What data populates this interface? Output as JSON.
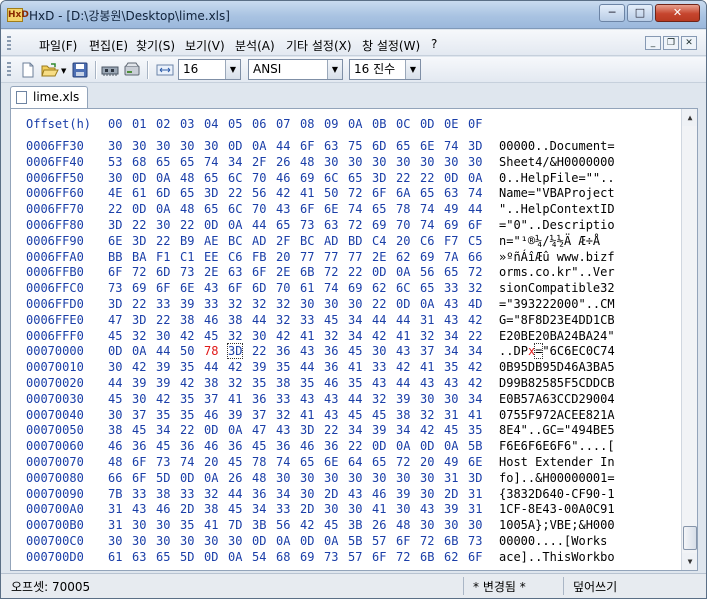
{
  "window": {
    "title": "HxD - [D:\\강봉원\\Desktop\\lime.xls]",
    "app_icon": "hxd-app-icon",
    "caption": {
      "minimize": "─",
      "maximize": "□",
      "close": "✕"
    }
  },
  "menu": {
    "items": [
      "파일(F)",
      "편집(E)",
      "찾기(S)",
      "보기(V)",
      "분석(A)",
      "기타 설정(X)",
      "창 설정(W)",
      "?"
    ],
    "mdi": {
      "minimize": "_",
      "restore": "❐",
      "close": "✕"
    }
  },
  "toolbar": {
    "bytes_per_row": "16",
    "charset": "ANSI",
    "offset_base": "16 진수",
    "icons": [
      "new-file-icon",
      "open-file-icon",
      "save-icon",
      "ram-icon",
      "disk-icon",
      "bytes-per-row-icon"
    ]
  },
  "tab": {
    "label": "lime.xls"
  },
  "editor": {
    "offset_header": "Offset(h)",
    "columns": [
      "00",
      "01",
      "02",
      "03",
      "04",
      "05",
      "06",
      "07",
      "08",
      "09",
      "0A",
      "0B",
      "0C",
      "0D",
      "0E",
      "0F"
    ],
    "rows": [
      {
        "offset": "0006FF30",
        "bytes": [
          "30",
          "30",
          "30",
          "30",
          "30",
          "0D",
          "0A",
          "44",
          "6F",
          "63",
          "75",
          "6D",
          "65",
          "6E",
          "74",
          "3D"
        ],
        "ascii": "00000..Document="
      },
      {
        "offset": "0006FF40",
        "bytes": [
          "53",
          "68",
          "65",
          "65",
          "74",
          "34",
          "2F",
          "26",
          "48",
          "30",
          "30",
          "30",
          "30",
          "30",
          "30",
          "30"
        ],
        "ascii": "Sheet4/&H0000000"
      },
      {
        "offset": "0006FF50",
        "bytes": [
          "30",
          "0D",
          "0A",
          "48",
          "65",
          "6C",
          "70",
          "46",
          "69",
          "6C",
          "65",
          "3D",
          "22",
          "22",
          "0D",
          "0A"
        ],
        "ascii": "0..HelpFile=\"\".."
      },
      {
        "offset": "0006FF60",
        "bytes": [
          "4E",
          "61",
          "6D",
          "65",
          "3D",
          "22",
          "56",
          "42",
          "41",
          "50",
          "72",
          "6F",
          "6A",
          "65",
          "63",
          "74"
        ],
        "ascii": "Name=\"VBAProject"
      },
      {
        "offset": "0006FF70",
        "bytes": [
          "22",
          "0D",
          "0A",
          "48",
          "65",
          "6C",
          "70",
          "43",
          "6F",
          "6E",
          "74",
          "65",
          "78",
          "74",
          "49",
          "44"
        ],
        "ascii": "\"..HelpContextID"
      },
      {
        "offset": "0006FF80",
        "bytes": [
          "3D",
          "22",
          "30",
          "22",
          "0D",
          "0A",
          "44",
          "65",
          "73",
          "63",
          "72",
          "69",
          "70",
          "74",
          "69",
          "6F"
        ],
        "ascii": "=\"0\"..Descriptio"
      },
      {
        "offset": "0006FF90",
        "bytes": [
          "6E",
          "3D",
          "22",
          "B9",
          "AE",
          "BC",
          "AD",
          "2F",
          "BC",
          "AD",
          "BD",
          "C4",
          "20",
          "C6",
          "F7",
          "C5"
        ],
        "ascii": "n=\"¹®¼­/¼­½Ä Æ÷Å"
      },
      {
        "offset": "0006FFA0",
        "bytes": [
          "BB",
          "BA",
          "F1",
          "C1",
          "EE",
          "C6",
          "FB",
          "20",
          "77",
          "77",
          "77",
          "2E",
          "62",
          "69",
          "7A",
          "66"
        ],
        "ascii": "»ºñÁîÆû www.bizf"
      },
      {
        "offset": "0006FFB0",
        "bytes": [
          "6F",
          "72",
          "6D",
          "73",
          "2E",
          "63",
          "6F",
          "2E",
          "6B",
          "72",
          "22",
          "0D",
          "0A",
          "56",
          "65",
          "72"
        ],
        "ascii": "orms.co.kr\"..Ver"
      },
      {
        "offset": "0006FFC0",
        "bytes": [
          "73",
          "69",
          "6F",
          "6E",
          "43",
          "6F",
          "6D",
          "70",
          "61",
          "74",
          "69",
          "62",
          "6C",
          "65",
          "33",
          "32"
        ],
        "ascii": "sionCompatible32"
      },
      {
        "offset": "0006FFD0",
        "bytes": [
          "3D",
          "22",
          "33",
          "39",
          "33",
          "32",
          "32",
          "32",
          "30",
          "30",
          "30",
          "22",
          "0D",
          "0A",
          "43",
          "4D"
        ],
        "ascii": "=\"393222000\"..CM"
      },
      {
        "offset": "0006FFE0",
        "bytes": [
          "47",
          "3D",
          "22",
          "38",
          "46",
          "38",
          "44",
          "32",
          "33",
          "45",
          "34",
          "44",
          "44",
          "31",
          "43",
          "42"
        ],
        "ascii": "G=\"8F8D23E4DD1CB"
      },
      {
        "offset": "0006FFF0",
        "bytes": [
          "45",
          "32",
          "30",
          "42",
          "45",
          "32",
          "30",
          "42",
          "41",
          "32",
          "34",
          "42",
          "41",
          "32",
          "34",
          "22"
        ],
        "ascii": "E20BE20BA24BA24\""
      },
      {
        "offset": "00070000",
        "bytes": [
          "0D",
          "0A",
          "44",
          "50",
          "78",
          "3D",
          "22",
          "36",
          "43",
          "36",
          "45",
          "30",
          "43",
          "37",
          "34",
          "34"
        ],
        "ascii": "..DPx=\"6C6EC0C74",
        "highlight_col": 4,
        "cursor_col": 5
      },
      {
        "offset": "00070010",
        "bytes": [
          "30",
          "42",
          "39",
          "35",
          "44",
          "42",
          "39",
          "35",
          "44",
          "36",
          "41",
          "33",
          "42",
          "41",
          "35",
          "42"
        ],
        "ascii": "0B95DB95D46A3BA5"
      },
      {
        "offset": "00070020",
        "bytes": [
          "44",
          "39",
          "39",
          "42",
          "38",
          "32",
          "35",
          "38",
          "35",
          "46",
          "35",
          "43",
          "44",
          "43",
          "43",
          "42"
        ],
        "ascii": "D99B82585F5CDDCB"
      },
      {
        "offset": "00070030",
        "bytes": [
          "45",
          "30",
          "42",
          "35",
          "37",
          "41",
          "36",
          "33",
          "43",
          "43",
          "44",
          "32",
          "39",
          "30",
          "30",
          "34"
        ],
        "ascii": "E0B57A63CCD29004"
      },
      {
        "offset": "00070040",
        "bytes": [
          "30",
          "37",
          "35",
          "35",
          "46",
          "39",
          "37",
          "32",
          "41",
          "43",
          "45",
          "45",
          "38",
          "32",
          "31",
          "41"
        ],
        "ascii": "0755F972ACEE821A"
      },
      {
        "offset": "00070050",
        "bytes": [
          "38",
          "45",
          "34",
          "22",
          "0D",
          "0A",
          "47",
          "43",
          "3D",
          "22",
          "34",
          "39",
          "34",
          "42",
          "45",
          "35"
        ],
        "ascii": "8E4\"..GC=\"494BE5"
      },
      {
        "offset": "00070060",
        "bytes": [
          "46",
          "36",
          "45",
          "36",
          "46",
          "36",
          "45",
          "36",
          "46",
          "36",
          "22",
          "0D",
          "0A",
          "0D",
          "0A",
          "5B"
        ],
        "ascii": "F6E6F6E6F6\"....["
      },
      {
        "offset": "00070070",
        "bytes": [
          "48",
          "6F",
          "73",
          "74",
          "20",
          "45",
          "78",
          "74",
          "65",
          "6E",
          "64",
          "65",
          "72",
          "20",
          "49",
          "6E"
        ],
        "ascii": "Host Extender In"
      },
      {
        "offset": "00070080",
        "bytes": [
          "66",
          "6F",
          "5D",
          "0D",
          "0A",
          "26",
          "48",
          "30",
          "30",
          "30",
          "30",
          "30",
          "30",
          "30",
          "31",
          "3D"
        ],
        "ascii": "fo]..&H00000001="
      },
      {
        "offset": "00070090",
        "bytes": [
          "7B",
          "33",
          "38",
          "33",
          "32",
          "44",
          "36",
          "34",
          "30",
          "2D",
          "43",
          "46",
          "39",
          "30",
          "2D",
          "31"
        ],
        "ascii": "{3832D640-CF90-1"
      },
      {
        "offset": "000700A0",
        "bytes": [
          "31",
          "43",
          "46",
          "2D",
          "38",
          "45",
          "34",
          "33",
          "2D",
          "30",
          "30",
          "41",
          "30",
          "43",
          "39",
          "31"
        ],
        "ascii": "1CF-8E43-00A0C91"
      },
      {
        "offset": "000700B0",
        "bytes": [
          "31",
          "30",
          "30",
          "35",
          "41",
          "7D",
          "3B",
          "56",
          "42",
          "45",
          "3B",
          "26",
          "48",
          "30",
          "30",
          "30"
        ],
        "ascii": "1005A};VBE;&H000"
      },
      {
        "offset": "000700C0",
        "bytes": [
          "30",
          "30",
          "30",
          "30",
          "30",
          "30",
          "0D",
          "0A",
          "0D",
          "0A",
          "5B",
          "57",
          "6F",
          "72",
          "6B",
          "73"
        ],
        "ascii": "00000....[Works"
      },
      {
        "offset": "000700D0",
        "bytes": [
          "61",
          "63",
          "65",
          "5D",
          "0D",
          "0A",
          "54",
          "68",
          "69",
          "73",
          "57",
          "6F",
          "72",
          "6B",
          "62",
          "6F"
        ],
        "ascii": "ace]..ThisWorkbo"
      }
    ]
  },
  "status": {
    "offset": "오프셋: 70005",
    "modified": "* 변경됨 *",
    "mode": "덮어쓰기"
  }
}
